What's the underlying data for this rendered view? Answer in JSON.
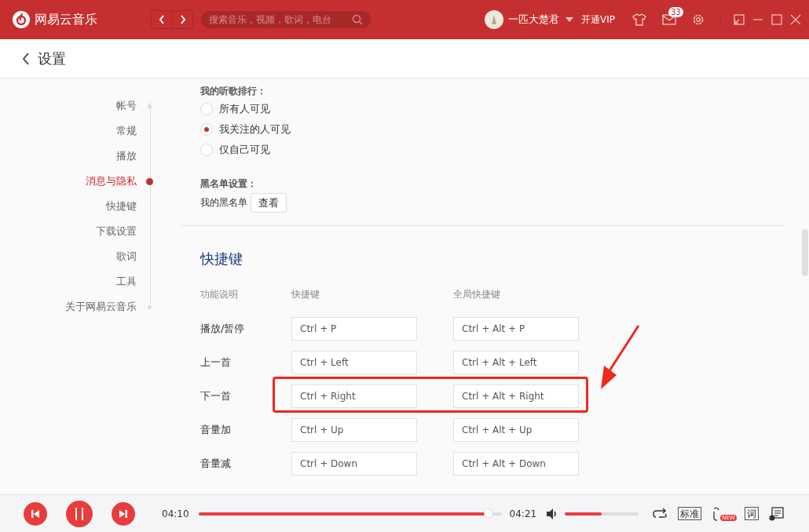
{
  "title_bar": {
    "app_name": "网易云音乐",
    "search": {
      "placeholder": "搜索音乐，视频，歌词，电台"
    },
    "user_name": "一匹大楚君",
    "vip_link": "开通VIP",
    "mail_badge": "33"
  },
  "header": {
    "title": "设置"
  },
  "sidebar": {
    "items": [
      {
        "label": "帐号",
        "selected": false
      },
      {
        "label": "常规",
        "selected": false
      },
      {
        "label": "播放",
        "selected": false
      },
      {
        "label": "消息与隐私",
        "selected": true
      },
      {
        "label": "快捷键",
        "selected": false
      },
      {
        "label": "下载设置",
        "selected": false
      },
      {
        "label": "歌词",
        "selected": false
      },
      {
        "label": "工具",
        "selected": false
      },
      {
        "label": "关于网易云音乐",
        "selected": false
      }
    ]
  },
  "ranking": {
    "title": "我的听歌排行：",
    "options": [
      {
        "label": "所有人可见",
        "selected": false
      },
      {
        "label": "我关注的人可见",
        "selected": true
      },
      {
        "label": "仅自己可见",
        "selected": false
      }
    ]
  },
  "blacklist": {
    "title": "黑名单设置：",
    "label": "我的黑名单",
    "button": "查看"
  },
  "shortcuts": {
    "title": "快捷键",
    "columns": [
      "功能说明",
      "快捷键",
      "全局快捷键"
    ],
    "rows": [
      {
        "action": "播放/暂停",
        "local": "Ctrl + P",
        "global": "Ctrl + Alt + P",
        "highlighted": false
      },
      {
        "action": "上一首",
        "local": "Ctrl + Left",
        "global": "Ctrl + Alt + Left",
        "highlighted": false
      },
      {
        "action": "下一首",
        "local": "Ctrl + Right",
        "global": "Ctrl + Alt + Right",
        "highlighted": true
      },
      {
        "action": "音量加",
        "local": "Ctrl + Up",
        "global": "Ctrl + Alt + Up",
        "highlighted": false
      },
      {
        "action": "音量减",
        "local": "Ctrl + Down",
        "global": "Ctrl + Alt + Down",
        "highlighted": false
      }
    ]
  },
  "player": {
    "elapsed": "04:10",
    "duration": "04:21",
    "progress": {
      "level": 0.96
    },
    "volume": {
      "level": 0.5
    },
    "quality": "标准",
    "lyrics": "词",
    "new_badge": "NEW"
  }
}
